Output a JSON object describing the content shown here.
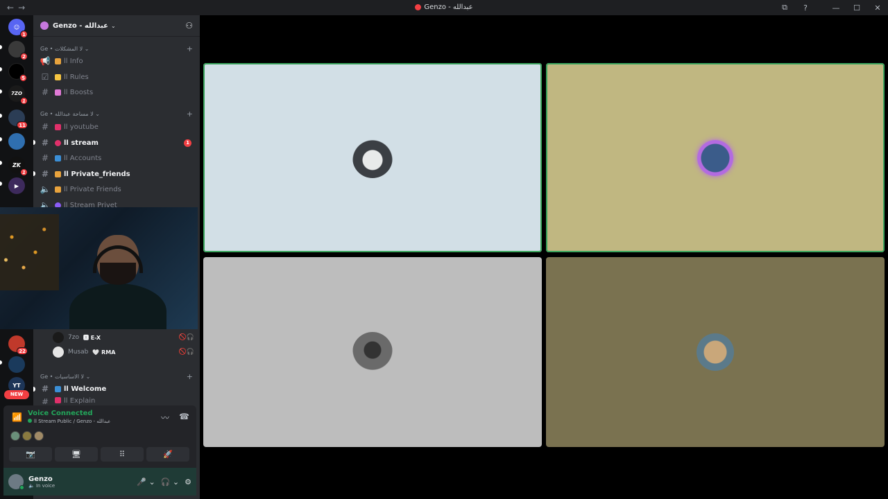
{
  "window": {
    "title": "Genzo - عبدالله",
    "nav_back": "←",
    "nav_forward": "→",
    "controls": [
      "⧉",
      "?",
      "—",
      "☐",
      "✕"
    ]
  },
  "guilds": {
    "items": [
      {
        "name": "discord-home",
        "badge": "1",
        "color": "#5865f2"
      },
      {
        "name": "server-2",
        "badge": "2",
        "color": "#3a3a3a"
      },
      {
        "name": "server-3",
        "badge": "5",
        "color": "#000000"
      },
      {
        "name": "server-7zo",
        "badge": "1",
        "color": "#222222"
      },
      {
        "name": "server-5",
        "badge": "11",
        "color": "#2b3d55"
      },
      {
        "name": "server-6",
        "badge": "",
        "color": "#2f6fb0"
      },
      {
        "name": "server-7",
        "badge": "1",
        "color": "#111111"
      },
      {
        "name": "server-8",
        "badge": "",
        "color": "#3d2a5c"
      },
      {
        "name": "server-9",
        "badge": "",
        "color": "#1e4a8a"
      },
      {
        "name": "server-10",
        "badge": "22",
        "color": "#c0392b"
      },
      {
        "name": "server-11",
        "badge": "",
        "color": "#1a3a5c"
      },
      {
        "name": "server-yt",
        "badge": "",
        "color": "#1d3557",
        "label": "YT"
      }
    ],
    "new_label": "NEW"
  },
  "server": {
    "name": "Genzo - عبدالله",
    "chevron": "⌄",
    "invite_icon": "👤+"
  },
  "categories": [
    {
      "label": "Ge • لا المشكلات ⌄",
      "plus": "+"
    },
    {
      "label": "Ge • لا مساحة عبدالله ⌄",
      "plus": "+"
    },
    {
      "label": "Ge • لا الاساسيات ⌄",
      "plus": "+"
    }
  ],
  "channels": [
    {
      "label": "اا Info",
      "emoji_color": "#e8a33d",
      "icon": "📢",
      "unread": false
    },
    {
      "label": "اا Rules",
      "emoji_color": "#f5c542",
      "icon": "☑",
      "unread": false
    },
    {
      "label": "اا Boosts",
      "emoji_color": "#e07ad6",
      "icon": "#",
      "unread": false
    },
    {
      "label": "اا youtube",
      "emoji_color": "#e0306a",
      "icon": "#",
      "unread": false
    },
    {
      "label": "اا stream",
      "emoji_color": "#e0306a",
      "icon": "#",
      "unread": true,
      "count": "1"
    },
    {
      "label": "اا Accounts",
      "emoji_color": "#3b8fd6",
      "icon": "#",
      "unread": false
    },
    {
      "label": "اا Private_friends",
      "emoji_color": "#e8a33d",
      "icon": "#",
      "unread": true
    },
    {
      "label": "اا Private Friends",
      "emoji_color": "#e8a33d",
      "icon": "🔊",
      "unread": false
    },
    {
      "label": "اا Stream Privet",
      "emoji_color": "#8b5cf6",
      "icon": "🔊",
      "unread": false
    },
    {
      "label": "اا Welcome",
      "emoji_color": "#3b8fd6",
      "icon": "#",
      "unread": true
    },
    {
      "label": "اا Explain",
      "emoji_color": "#e0306a",
      "icon": "#",
      "unread": false
    }
  ],
  "voice_users": [
    {
      "name": "7zo",
      "tag": "🆇 E-X",
      "icons": "🚫🎧"
    },
    {
      "name": "Musab",
      "tag": "🤍 RMA",
      "icons": "🚫🎧"
    }
  ],
  "voice_panel": {
    "status": "Voice Connected",
    "channel": "اا Stream Public / Genzo - عبدالله",
    "buttons": [
      "📷̸",
      "🖥",
      "⠿",
      "🚀"
    ],
    "noise_icon": "〰",
    "disconnect_icon": "☎"
  },
  "user": {
    "name": "Genzo",
    "status": "In voice",
    "mic": "🎤 ⌄",
    "headset": "🎧 ⌄",
    "settings": "⚙"
  },
  "tiles": [
    {
      "name": "tile-user-hooded",
      "bg": "#d2dfe6",
      "speaking": true,
      "avatar_color": "#555b60"
    },
    {
      "name": "tile-user-messi",
      "bg": "#c0b781",
      "speaking": true,
      "avatar_color": "#8a2be2"
    },
    {
      "name": "tile-user-desk",
      "bg": "#bdbdbd",
      "speaking": false,
      "avatar_color": "#4a4a4a"
    },
    {
      "name": "tile-user-mustache",
      "bg": "#7a7250",
      "speaking": false,
      "avatar_color": "#a8865a"
    }
  ]
}
